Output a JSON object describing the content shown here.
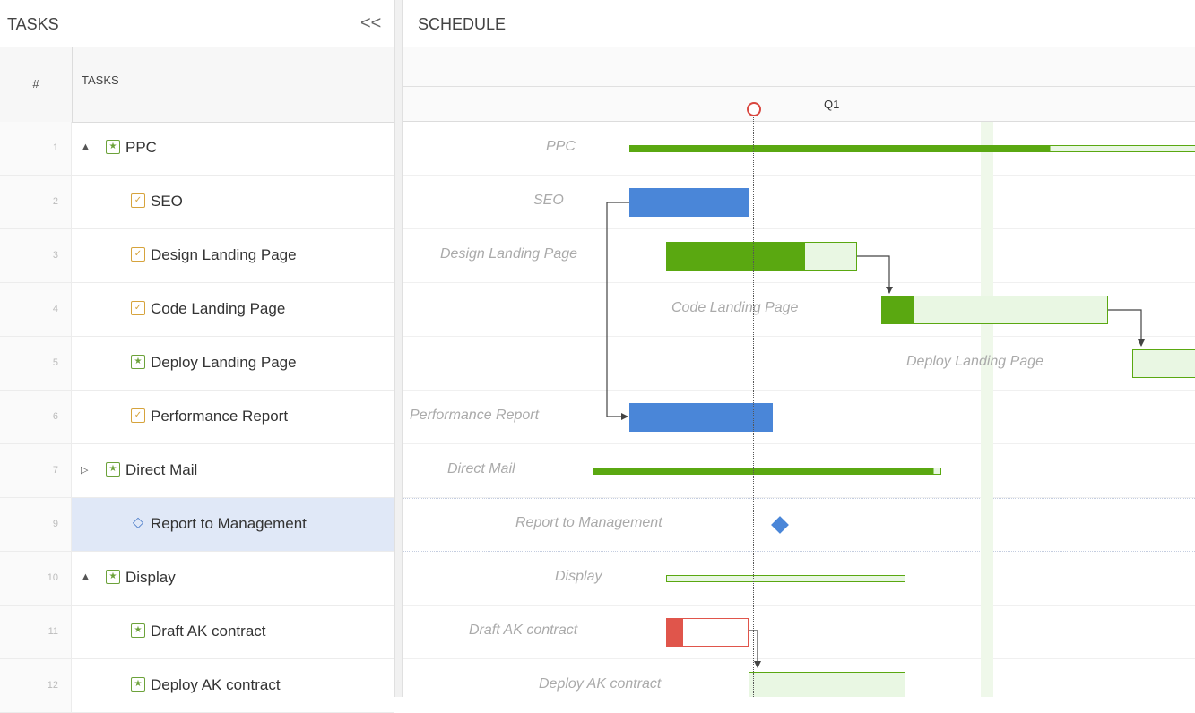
{
  "header": {
    "tasks_title": "TASKS",
    "collapse_glyph": "<<",
    "schedule_title": "SCHEDULE"
  },
  "grid": {
    "col_num": "#",
    "col_tasks": "TASKS"
  },
  "timeline": {
    "quarter_label": "Q1"
  },
  "tasks": [
    {
      "num": "1",
      "label": "PPC",
      "type": "summary",
      "level": 0,
      "caret": "▲",
      "gantt_label": "PPC"
    },
    {
      "num": "2",
      "label": "SEO",
      "type": "task",
      "level": 1,
      "caret": "",
      "gantt_label": "SEO"
    },
    {
      "num": "3",
      "label": "Design Landing Page",
      "type": "task",
      "level": 1,
      "caret": "",
      "gantt_label": "Design Landing Page"
    },
    {
      "num": "4",
      "label": "Code Landing Page",
      "type": "task",
      "level": 1,
      "caret": "",
      "gantt_label": "Code Landing Page"
    },
    {
      "num": "5",
      "label": "Deploy Landing Page",
      "type": "summary",
      "level": 1,
      "caret": "",
      "gantt_label": "Deploy Landing Page"
    },
    {
      "num": "6",
      "label": "Performance Report",
      "type": "task",
      "level": 1,
      "caret": "",
      "gantt_label": "Performance Report"
    },
    {
      "num": "7",
      "label": "Direct Mail",
      "type": "summary",
      "level": 0,
      "caret": "▷",
      "gantt_label": "Direct Mail"
    },
    {
      "num": "9",
      "label": "Report to Management",
      "type": "milestone",
      "level": 1,
      "caret": "",
      "gantt_label": "Report to Management"
    },
    {
      "num": "10",
      "label": "Display",
      "type": "summary",
      "level": 0,
      "caret": "▲",
      "gantt_label": "Display"
    },
    {
      "num": "11",
      "label": "Draft AK contract",
      "type": "summary",
      "level": 1,
      "caret": "",
      "gantt_label": "Draft AK contract"
    },
    {
      "num": "12",
      "label": "Deploy AK contract",
      "type": "summary",
      "level": 1,
      "caret": "",
      "gantt_label": "Deploy AK contract"
    }
  ],
  "colors": {
    "green": "#5aa811",
    "green_light": "#e9f7e3",
    "blue": "#4a86d8",
    "red": "#e0554b",
    "selected_row": "#e0e8f7",
    "today_marker": "#d9473f"
  }
}
